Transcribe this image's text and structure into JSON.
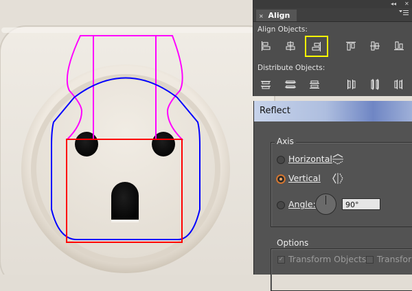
{
  "align_panel": {
    "tab_label": "Align",
    "close_glyph": "×",
    "collapse_glyph": "◂◂",
    "panel_close_glyph": "✕",
    "menu_icon": "panel-menu-icon",
    "align_objects_label": "Align Objects:",
    "distribute_objects_label": "Distribute Objects:",
    "align_buttons": [
      {
        "icon": "horizontal-align-left-icon"
      },
      {
        "icon": "horizontal-align-center-icon"
      },
      {
        "icon": "horizontal-align-right-icon",
        "selected": true
      },
      {
        "icon": "vertical-align-top-icon"
      },
      {
        "icon": "vertical-align-center-icon"
      },
      {
        "icon": "vertical-align-bottom-icon"
      }
    ],
    "distribute_buttons": [
      {
        "icon": "vertical-distribute-top-icon"
      },
      {
        "icon": "vertical-distribute-center-icon"
      },
      {
        "icon": "vertical-distribute-bottom-icon"
      },
      {
        "icon": "horizontal-distribute-left-icon"
      },
      {
        "icon": "horizontal-distribute-center-icon"
      },
      {
        "icon": "horizontal-distribute-right-icon"
      }
    ],
    "highlight_color": "#ffff00"
  },
  "reflect_dialog": {
    "title": "Reflect",
    "axis_group_label": "Axis",
    "horizontal_label": "Horizontal",
    "vertical_label": "Vertical",
    "angle_label": "Angle:",
    "angle_value": "90°",
    "selected_axis": "Vertical",
    "options_group_label": "Options",
    "transform_objects_label": "Transform Objects",
    "transform_patterns_label": "Transform",
    "transform_objects_checked": true,
    "transform_patterns_checked": false
  },
  "canvas": {
    "guide_colors": {
      "magenta": "#ff00ff",
      "blue": "#0000ff",
      "red": "#ff0000"
    },
    "outlet_plate_color": "#e8e3da"
  }
}
